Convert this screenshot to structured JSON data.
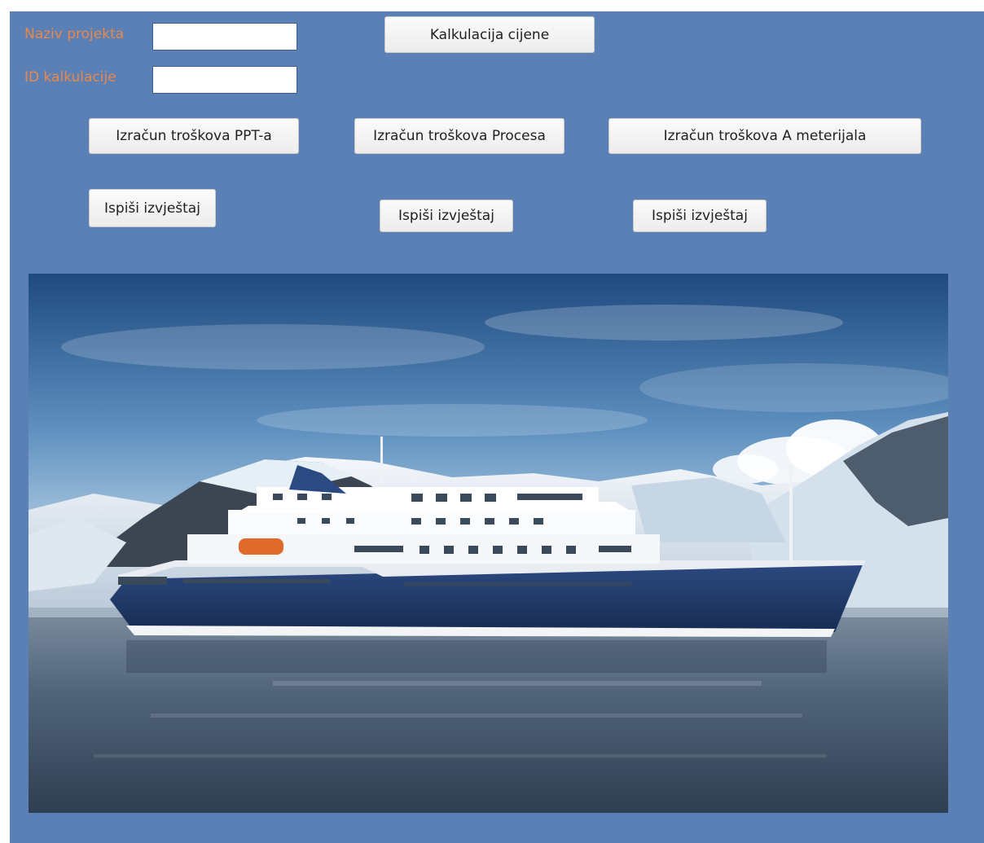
{
  "form": {
    "fields": {
      "project_name": {
        "label": "Naziv projekta",
        "value": ""
      },
      "calculation_id": {
        "label": "ID kalkulacije",
        "value": ""
      }
    },
    "buttons": {
      "price_calculation": "Kalkulacija cijene",
      "ppt_cost": "Izračun troškova PPT-a",
      "process_cost": "Izračun troškova Procesa",
      "a_material_cost": "Izračun troškova A meterijala",
      "print_report_1": "Ispiši izvještaj",
      "print_report_2": "Ispiši izvještaj",
      "print_report_3": "Ispiši izvještaj"
    },
    "colors": {
      "background": "#5b80b6",
      "label": "#e8884a",
      "button": "#f4f4f4"
    }
  },
  "image": {
    "subject": "expedition cruise ship in polar fjord",
    "icon": "photo"
  }
}
